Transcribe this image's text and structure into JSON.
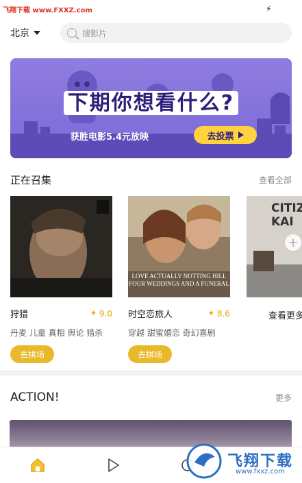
{
  "status_bar": {
    "watermark": "飞翔下载 www.FXXZ.com",
    "charge_icon": "bolt-icon"
  },
  "header": {
    "city": "北京",
    "search_placeholder": "搜影片"
  },
  "banner": {
    "title": "下期你想看什么?",
    "subtitle": "获胜电影5.4元放映",
    "button_label": "去投票"
  },
  "section_collecting": {
    "title": "正在召集",
    "link": "查看全部"
  },
  "movies": [
    {
      "name": "狩猎",
      "rating": "9.0",
      "tags": "丹麦 儿童 真相 舆论 猎杀",
      "button": "去拼场",
      "poster_text": ""
    },
    {
      "name": "时空恋旅人",
      "rating": "8.6",
      "tags": "穿越 甜蜜婚恋 奇幻喜剧",
      "button": "去拼场",
      "poster_text": "LOVE ACTUALLY NOTTING HILL FOUR WEDDINGS AND A FUNERAL"
    }
  ],
  "third_poster_text": "CITIZ KAI",
  "see_more": "查看更多",
  "section_action": {
    "title": "ACTION!",
    "link": "更多"
  },
  "tabbar": {
    "items": [
      "home-icon",
      "play-icon",
      "discover-icon",
      "profile-icon"
    ]
  },
  "watermark_bottom": {
    "text": "飞翔下载",
    "url": "www.fxxz.com"
  },
  "colors": {
    "accent": "#eab92b",
    "banner_bg": "#8f7de0",
    "rating": "#f2a500"
  }
}
